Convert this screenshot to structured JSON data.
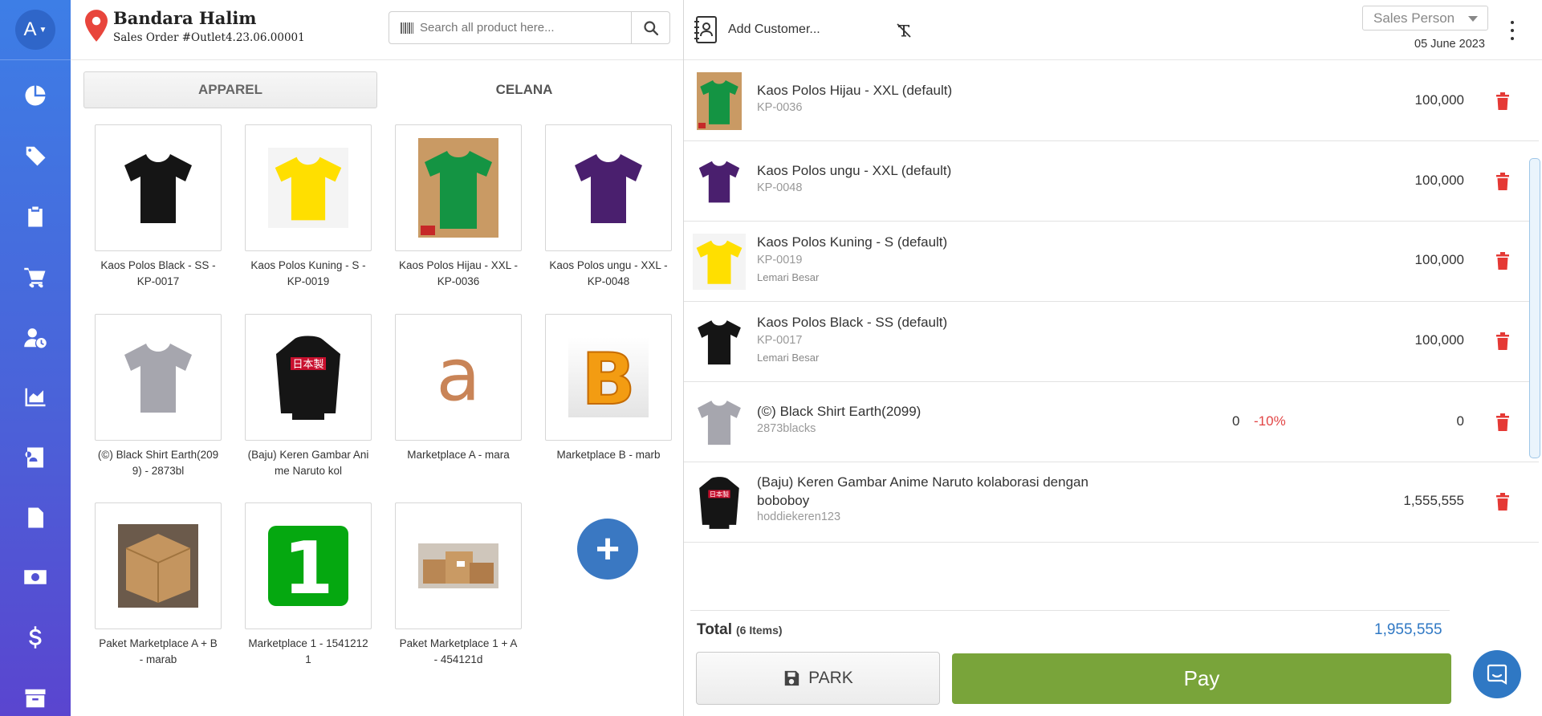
{
  "sidebar": {
    "avatar_initial": "A",
    "items": [
      {
        "name": "dashboard",
        "icon": "pie-chart-icon"
      },
      {
        "name": "products",
        "icon": "tag-icon"
      },
      {
        "name": "orders",
        "icon": "clipboard-icon"
      },
      {
        "name": "sales",
        "icon": "cart-icon"
      },
      {
        "name": "customers",
        "icon": "user-clock-icon"
      },
      {
        "name": "reports",
        "icon": "area-chart-icon"
      },
      {
        "name": "contacts",
        "icon": "id-card-icon"
      },
      {
        "name": "invoices",
        "icon": "document-icon"
      },
      {
        "name": "cash",
        "icon": "money-icon"
      },
      {
        "name": "finance",
        "icon": "dollar-icon"
      },
      {
        "name": "archive",
        "icon": "archive-icon"
      }
    ]
  },
  "store": {
    "name": "Bandara Halim",
    "order_number": "Sales Order #Outlet4.23.06.00001"
  },
  "search": {
    "placeholder": "Search all product here..."
  },
  "tabs": [
    {
      "label": "APPAREL",
      "active": true
    },
    {
      "label": "CELANA",
      "active": false
    }
  ],
  "products": [
    {
      "name": "Kaos Polos Black - SS - KP-0017",
      "image": "black-tshirt"
    },
    {
      "name": "Kaos Polos Kuning - S - KP-0019",
      "image": "yellow-tshirt"
    },
    {
      "name": "Kaos Polos Hijau - XXL - KP-0036",
      "image": "green-tshirt-photo"
    },
    {
      "name": "Kaos Polos ungu - XXL - KP-0048",
      "image": "purple-tshirt"
    },
    {
      "name": "(©) Black Shirt Earth(2099) - 2873bl",
      "image": "grey-tshirt"
    },
    {
      "name": "(Baju) Keren Gambar Anime Naruto kol",
      "image": "black-hoodie"
    },
    {
      "name": "Marketplace A - mara",
      "image": "letter-a"
    },
    {
      "name": "Marketplace B - marb",
      "image": "letter-b"
    },
    {
      "name": "Paket Marketplace A + B - marab",
      "image": "cardboard-box"
    },
    {
      "name": "Marketplace 1 - 15412121",
      "image": "number-one"
    },
    {
      "name": "Paket Marketplace 1 + A - 454121d",
      "image": "parcels"
    }
  ],
  "cart": {
    "add_customer": "Add Customer...",
    "sales_person_placeholder": "Sales Person",
    "date": "05 June 2023",
    "items": [
      {
        "title": "Kaos Polos Hijau - XXL (default)",
        "sku": "KP-0036",
        "location": "",
        "qty": "",
        "discount": "",
        "price": "100,000",
        "image": "green-tshirt-photo"
      },
      {
        "title": "Kaos Polos ungu - XXL (default)",
        "sku": "KP-0048",
        "location": "",
        "qty": "",
        "discount": "",
        "price": "100,000",
        "image": "purple-tshirt"
      },
      {
        "title": "Kaos Polos Kuning - S (default)",
        "sku": "KP-0019",
        "location": "Lemari Besar",
        "qty": "",
        "discount": "",
        "price": "100,000",
        "image": "yellow-tshirt"
      },
      {
        "title": "Kaos Polos Black - SS (default)",
        "sku": "KP-0017",
        "location": "Lemari Besar",
        "qty": "",
        "discount": "",
        "price": "100,000",
        "image": "black-tshirt"
      },
      {
        "title": "(©) Black Shirt Earth(2099)",
        "sku": "2873blacks",
        "location": "",
        "qty": "0",
        "discount": "-10%",
        "price": "0",
        "image": "grey-tshirt"
      },
      {
        "title": "(Baju) Keren Gambar Anime Naruto kolaborasi dengan boboboy",
        "sku": "hoddiekeren123",
        "location": "",
        "qty": "",
        "discount": "",
        "price": "1,555,555",
        "image": "black-hoodie"
      }
    ],
    "total_label": "Total",
    "total_items": "(6 Items)",
    "total_value": "1,955,555",
    "park_label": "PARK",
    "pay_label": "Pay"
  },
  "colors": {
    "sidebar_top": "#3d7ee6",
    "sidebar_bottom": "#5a45cf",
    "pay_green": "#79a43a",
    "accent_blue": "#2f78c4",
    "delete_red": "#e53935"
  }
}
